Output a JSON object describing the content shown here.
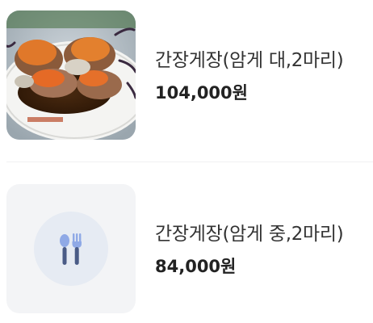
{
  "menu": {
    "items": [
      {
        "name": "간장게장(암게 대,2마리)",
        "price": "104,000원",
        "thumbnail": "crab-photo"
      },
      {
        "name": "간장게장(암게 중,2마리)",
        "price": "84,000원",
        "thumbnail": "fork-knife-icon"
      }
    ]
  },
  "colors": {
    "placeholder_bg": "#f3f4f6",
    "placeholder_circle": "#e6ebf3",
    "utensil_head": "#8fa9e6",
    "utensil_handle": "#4a5b86"
  }
}
